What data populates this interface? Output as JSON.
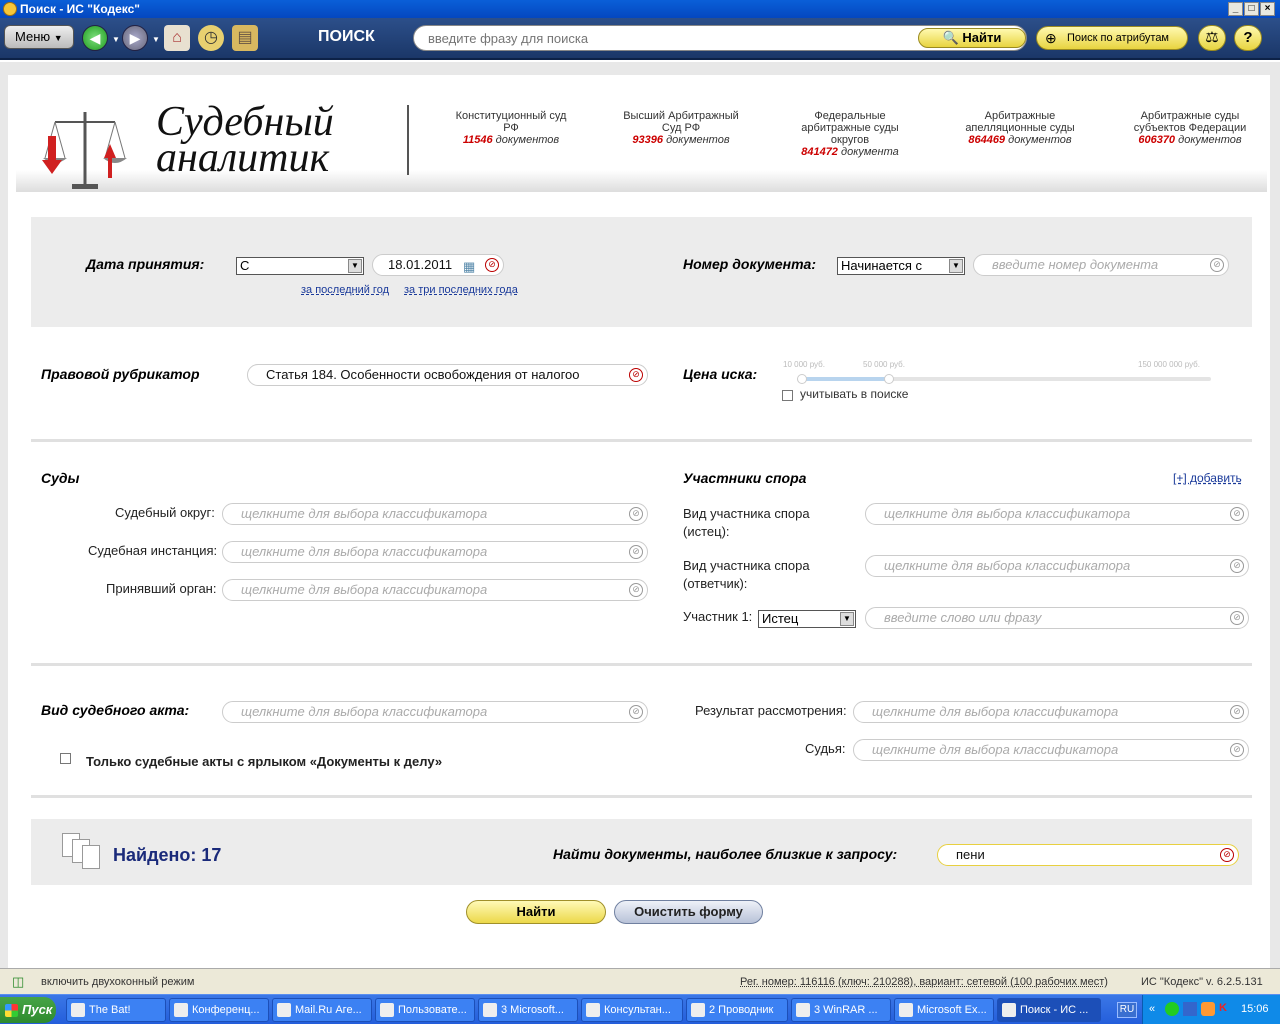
{
  "window": {
    "title": "Поиск - ИС \"Кодекс\""
  },
  "toolbar": {
    "menu_label": "Меню",
    "search_label": "ПОИСК",
    "search_placeholder": "введите фразу для поиска",
    "find_label": "Найти",
    "attr_search_label": "Поиск по атрибутам"
  },
  "header": {
    "logo_line1": "Судебный",
    "logo_line2": "аналитик",
    "courts": [
      {
        "name1": "Конституционный суд",
        "name2": "РФ",
        "name3": "",
        "count": "11546",
        "unit": "документов"
      },
      {
        "name1": "Высший Арбитражный",
        "name2": "Суд РФ",
        "name3": "",
        "count": "93396",
        "unit": "документов"
      },
      {
        "name1": "Федеральные",
        "name2": "арбитражные суды",
        "name3": "округов",
        "count": "841472",
        "unit": "документа"
      },
      {
        "name1": "Арбитражные",
        "name2": "апелляционные суды",
        "name3": "",
        "count": "864469",
        "unit": "документов"
      },
      {
        "name1": "Арбитражные суды",
        "name2": "субъектов Федерации",
        "name3": "",
        "count": "606370",
        "unit": "документов"
      }
    ]
  },
  "date_section": {
    "label": "Дата принятия:",
    "from_value": "С",
    "date_value": "18.01.2011",
    "link_last_year": "за последний год",
    "link_three_years": "за три последних года"
  },
  "docnum_section": {
    "label": "Номер документа:",
    "mode_value": "Начинается с",
    "placeholder": "введите номер документа"
  },
  "rubric_section": {
    "label": "Правовой рубрикатор",
    "value": "Статья 184. Особенности освобождения от налогоо"
  },
  "price_section": {
    "label": "Цена иска:",
    "tick_min": "10 000 руб.",
    "tick_mid": "50 000 руб.",
    "tick_max": "150 000 000 руб.",
    "checkbox_label": "учитывать в поиске"
  },
  "courts_section": {
    "title": "Суды",
    "rows": [
      {
        "label": "Судебный округ:",
        "placeholder": "щелкните для выбора классификатора"
      },
      {
        "label": "Судебная инстанция:",
        "placeholder": "щелкните для выбора классификатора"
      },
      {
        "label": "Принявший орган:",
        "placeholder": "щелкните для выбора классификатора"
      }
    ]
  },
  "participants_section": {
    "title": "Участники спора",
    "add_link": "[+] добавить",
    "plaintiff_label1": "Вид участника спора",
    "plaintiff_label2": "(истец):",
    "defendant_label1": "Вид участника спора",
    "defendant_label2": "(ответчик):",
    "classifier_placeholder": "щелкните для выбора классификатора",
    "participant_label": "Участник 1:",
    "participant_role": "Истец",
    "participant_placeholder": "введите слово или фразу"
  },
  "act_section": {
    "label": "Вид судебного акта:",
    "placeholder": "щелкните для выбора классификатора",
    "checkbox_label": "Только судебные акты с ярлыком «Документы к делу»",
    "result_label": "Результат рассмотрения:",
    "judge_label": "Судья:"
  },
  "results": {
    "found_label": "Найдено: 17",
    "closest_label": "Найти документы, наиболее близкие к запросу:",
    "closest_value": "пени"
  },
  "buttons": {
    "find": "Найти",
    "clear": "Очистить форму"
  },
  "statusbar": {
    "dual_mode": "включить двухоконный режим",
    "reg_info": "Рег. номер: 116116 (ключ: 210288), вариант: сетевой (100 рабочих мест)",
    "version": "ИС \"Кодекс\" v. 6.2.5.131"
  },
  "taskbar": {
    "start": "Пуск",
    "tasks": [
      "The Bat!",
      "Конференц...",
      "Mail.Ru Аге...",
      "Пользовате...",
      "3 Microsoft...",
      "Консультан...",
      "2 Проводник",
      "3 WinRAR ...",
      "Microsoft Ex...",
      "Поиск - ИС ..."
    ],
    "lang": "RU",
    "clock": "15:06"
  }
}
